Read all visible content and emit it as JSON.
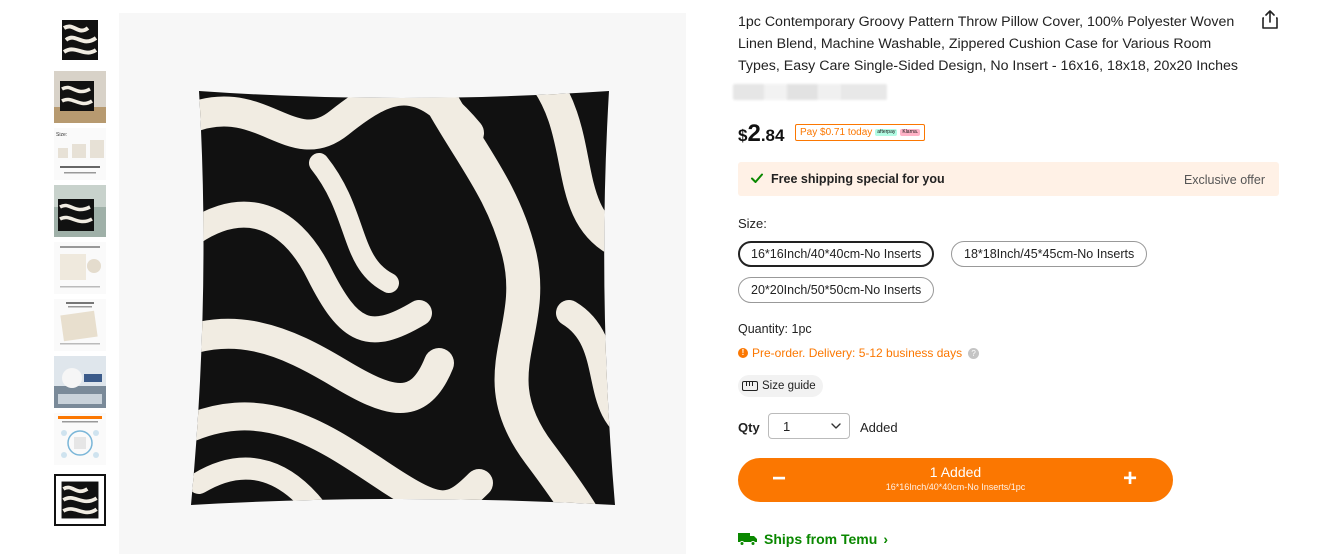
{
  "product": {
    "title": "1pc Contemporary Groovy Pattern Throw Pillow Cover, 100% Polyester Woven Linen Blend, Machine Washable, Zippered Cushion Case for Various Room Types, Easy Care Single-Sided Design, No Insert - 16x16, 18x18, 20x20 Inches"
  },
  "price": {
    "currency": "$",
    "whole": "2",
    "fraction": ".84",
    "pay_today": "Pay $0.71 today",
    "afterpay_label": "afterpay",
    "klarna_label": "Klarna."
  },
  "shipping_banner": {
    "free_text": "Free shipping special for you",
    "exclusive": "Exclusive offer"
  },
  "size": {
    "label": "Size:",
    "options": [
      "16*16Inch/40*40cm-No Inserts",
      "18*18Inch/45*45cm-No Inserts",
      "20*20Inch/50*50cm-No Inserts"
    ],
    "selected_index": 0
  },
  "quantity": {
    "text": "Quantity: 1pc",
    "preorder": "Pre-order. Delivery: 5-12 business days",
    "size_guide": "Size guide",
    "qty_label": "Qty",
    "qty_value": "1",
    "added": "Added"
  },
  "cart": {
    "line1": "1 Added",
    "line2": "16*16Inch/40*40cm-No Inserts/1pc",
    "minus": "−",
    "plus": "+"
  },
  "ships_from": "Ships from Temu",
  "colors": {
    "accent": "#fb7701",
    "green": "#0a8800",
    "banner_bg": "#fff1e6"
  },
  "thumbnails": {
    "count": 9,
    "selected_index": 8,
    "size_thumb_label": "Size:"
  }
}
